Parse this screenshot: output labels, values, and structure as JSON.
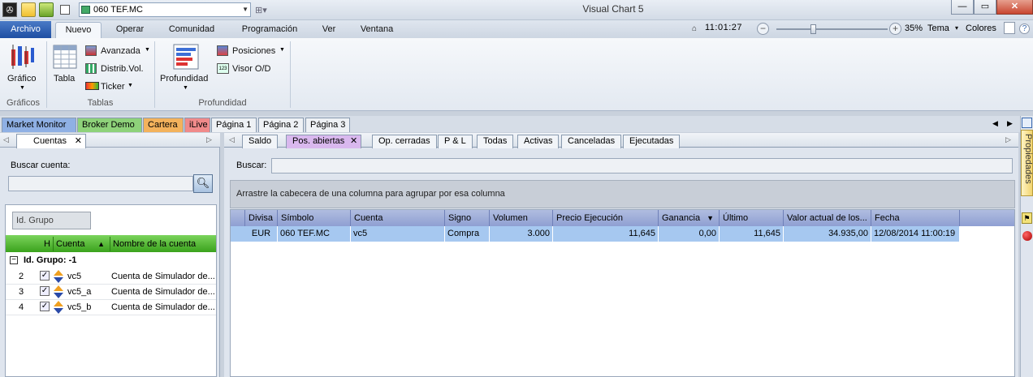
{
  "title_bar": {
    "app_title": "Visual Chart 5",
    "symbol": "060 TEF.MC",
    "window_buttons": [
      "—",
      "▭",
      "✕"
    ]
  },
  "menu": {
    "archivo": "Archivo",
    "tabs": [
      "Nuevo",
      "Operar",
      "Comunidad",
      "Programación",
      "Ver",
      "Ventana"
    ]
  },
  "status": {
    "time": "11:01:27",
    "zoom": "35%",
    "zoom_minus": "−",
    "zoom_plus": "+",
    "tema": "Tema",
    "colores": "Colores"
  },
  "ribbon": {
    "groups": [
      {
        "label": "Gráficos",
        "buttons": [
          "Gráfico"
        ]
      },
      {
        "label": "Tablas",
        "buttons": [
          "Tabla",
          "Avanzada",
          "Distrib.Vol.",
          "Ticker"
        ]
      },
      {
        "label": "Profundidad",
        "buttons": [
          "Profundidad",
          "Posiciones",
          "Visor O/D"
        ]
      }
    ]
  },
  "page_tabs": [
    "Market Monitor",
    "Broker Demo",
    "Cartera",
    "iLive",
    "Página 1",
    "Página 2",
    "Página 3"
  ],
  "page_tab_colors": [
    "#8fb0e4",
    "#8ed27a",
    "#f3b25c",
    "#f08a8a",
    "#eef1f5",
    "#eef1f5",
    "#eef1f5"
  ],
  "left_panel": {
    "tab": "Cuentas",
    "search_label": "Buscar cuenta:",
    "group_box": "Id. Grupo",
    "columns": [
      "H",
      "Cuenta",
      "Nombre de la cuenta"
    ],
    "group_row": "Id. Grupo: -1",
    "rows": [
      {
        "num": "2",
        "cuenta": "vc5",
        "nombre": "Cuenta de Simulador de..."
      },
      {
        "num": "3",
        "cuenta": "vc5_a",
        "nombre": "Cuenta de Simulador de..."
      },
      {
        "num": "4",
        "cuenta": "vc5_b",
        "nombre": "Cuenta de Simulador de..."
      }
    ]
  },
  "right_panel": {
    "tabs": [
      "Saldo",
      "Pos. abiertas",
      "Op. cerradas",
      "P & L",
      "Todas",
      "Activas",
      "Canceladas",
      "Ejecutadas"
    ],
    "active_tab": "Pos. abiertas",
    "search_label": "Buscar:",
    "group_hint": "Arrastre la cabecera de una columna para agrupar por esa columna",
    "columns": [
      "Divisa",
      "Símbolo",
      "Cuenta",
      "Signo",
      "Volumen",
      "Precio Ejecución",
      "Ganancia",
      "Último",
      "Valor actual de los...",
      "Fecha"
    ],
    "row": {
      "divisa": "EUR",
      "simbolo": "060 TEF.MC",
      "cuenta": "vc5",
      "signo": "Compra",
      "volumen": "3.000",
      "precio": "11,645",
      "ganancia": "0,00",
      "ultimo": "11,645",
      "valor": "34.935,00",
      "fecha": "12/08/2014 11:00:19"
    }
  },
  "side_dock": {
    "label": "Propiedades"
  }
}
